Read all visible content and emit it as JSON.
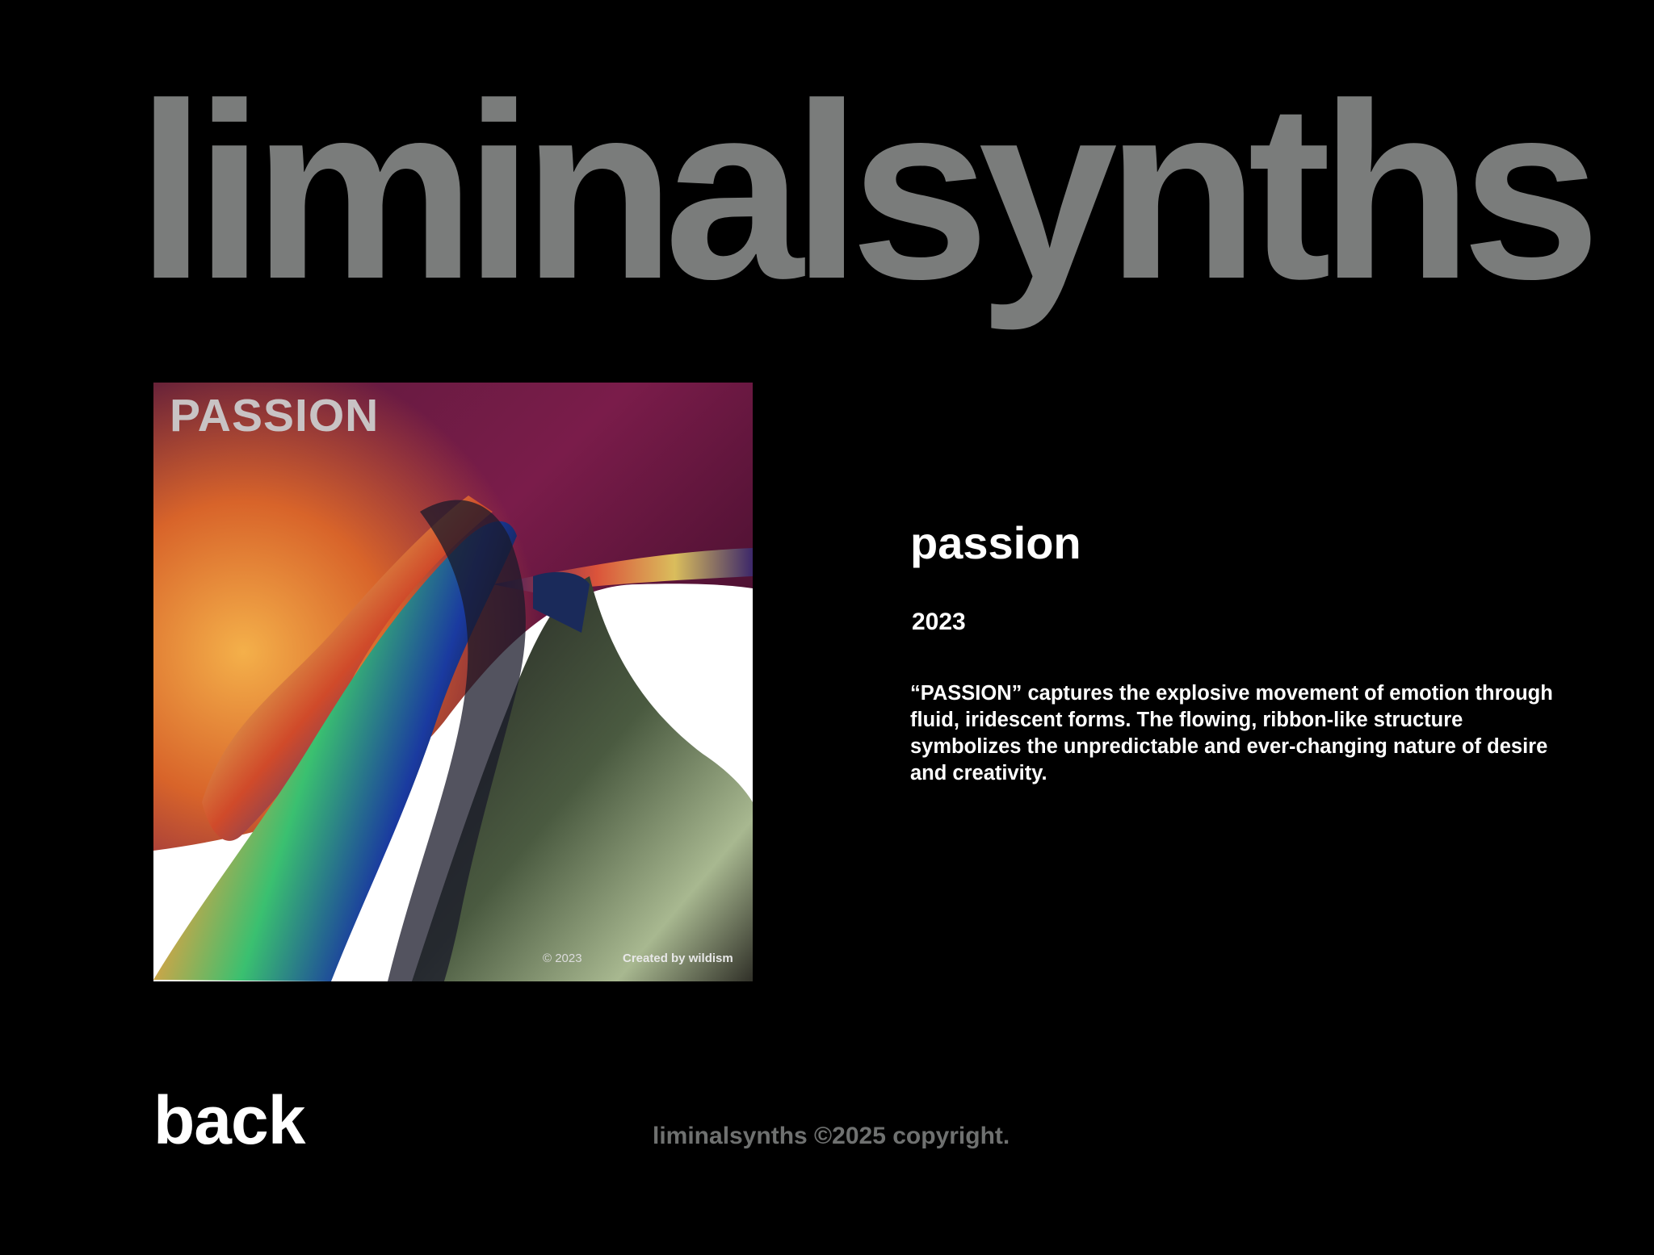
{
  "header": {
    "brand": "liminalsynths"
  },
  "artwork": {
    "cover_title": "PASSION",
    "cover_year": "© 2023",
    "cover_credit": "Created by wildism"
  },
  "work": {
    "title": "passion",
    "year": "2023",
    "description": "“PASSION” captures the explosive movement of emotion through fluid, iridescent forms. The flowing, ribbon-like structure symbolizes the unpredictable and ever-changing nature of desire and creativity."
  },
  "footer": {
    "back_label": "back",
    "copyright": "liminalsynths ©2025 copyright."
  },
  "colors": {
    "background": "#000000",
    "brand_gray": "#7a7c7b",
    "text": "#ffffff",
    "muted": "#6f7170"
  }
}
